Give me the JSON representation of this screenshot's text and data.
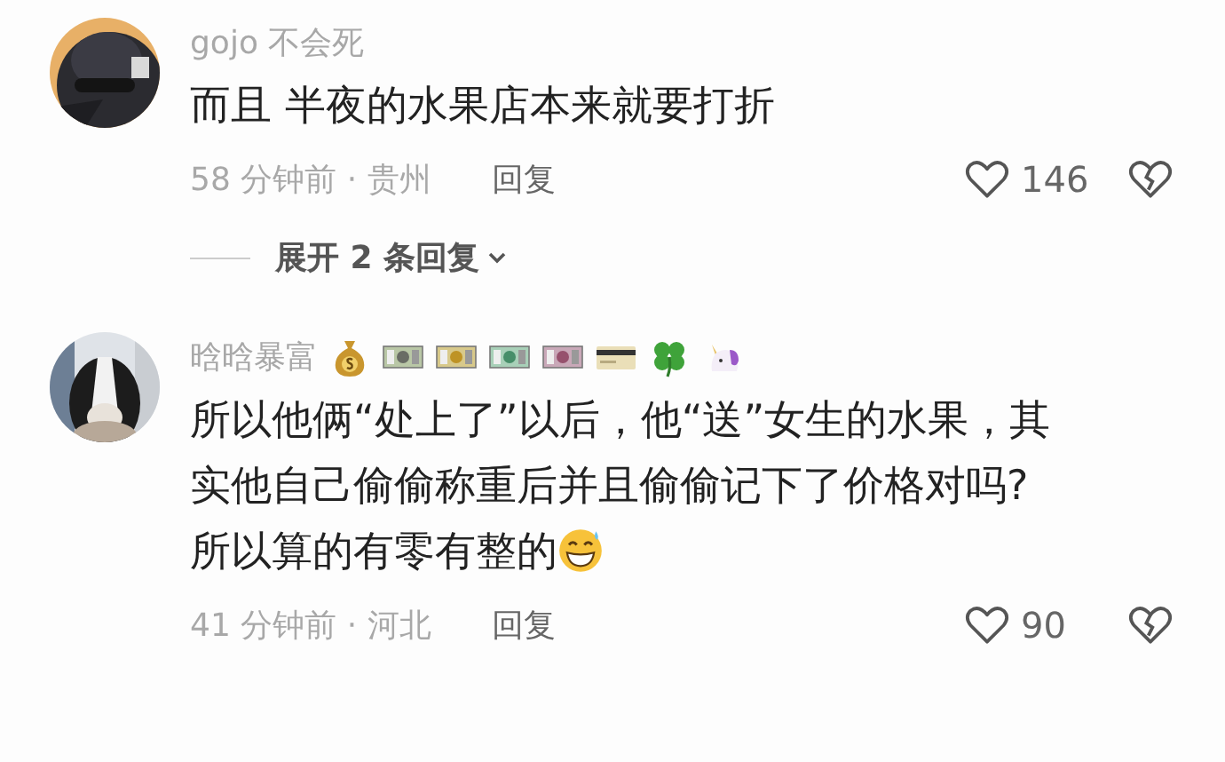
{
  "comments": [
    {
      "author": "gojo 不会死",
      "badges": false,
      "text": "而且 半夜的水果店本来就要打折",
      "trailing_emoji": false,
      "time": "58 分钟前 · 贵州",
      "reply": "回复",
      "likes": "146",
      "more_replies": "展开 2 条回复"
    },
    {
      "author": "晗晗暴富",
      "badges": true,
      "text": "所以他俩“处上了”以后，他“送”女生的水果，其实他自己偷偷称重后并且偷偷记下了价格对吗?所以算的有零有整的",
      "trailing_emoji": true,
      "time": "41 分钟前 · 河北",
      "reply": "回复",
      "likes": "90"
    }
  ]
}
